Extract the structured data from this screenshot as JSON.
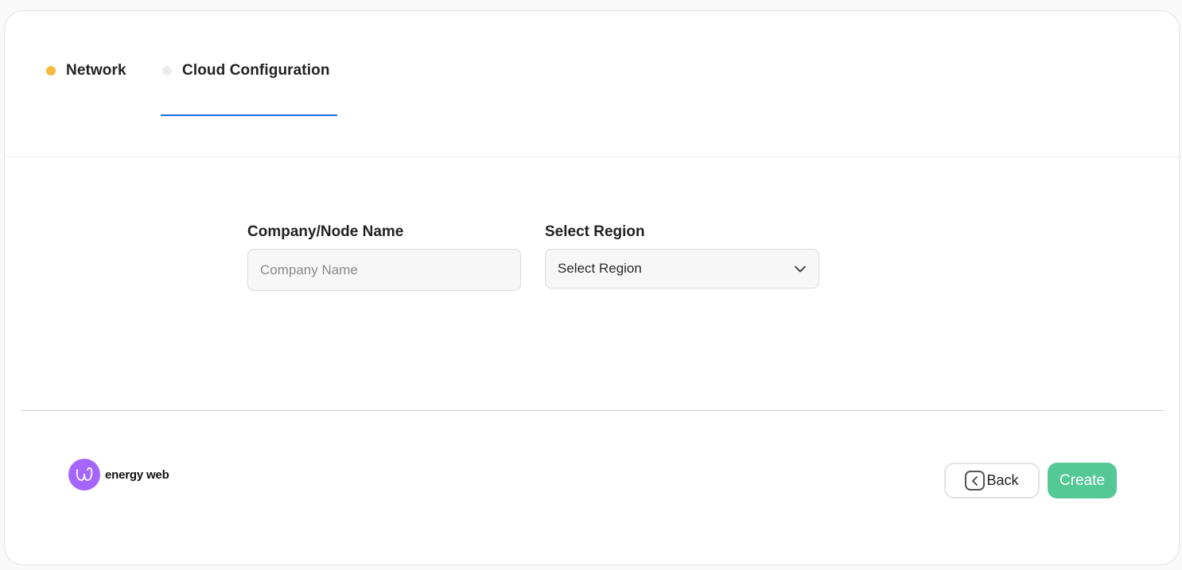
{
  "steps": [
    {
      "label": "Network",
      "dot_color": "#f7b93e",
      "state": "completed"
    },
    {
      "label": "Cloud Configuration",
      "dot_color": "#ececec",
      "state": "active"
    }
  ],
  "active_tab_color": "#1f6fe0",
  "form": {
    "company": {
      "label": "Company/Node Name",
      "placeholder": "Company Name",
      "value": ""
    },
    "region": {
      "label": "Select Region",
      "value": "Select Region",
      "icon": "chevron-down-icon"
    }
  },
  "logo": {
    "text": "energy web",
    "color": "#a566ff"
  },
  "actions": {
    "back": {
      "label": "Back",
      "icon": "back-arrow-icon"
    },
    "create": {
      "label": "Create",
      "color": "#54c895"
    }
  }
}
